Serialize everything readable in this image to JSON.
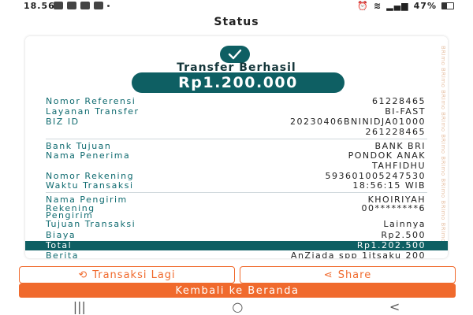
{
  "status_bar": {
    "time": "18.56",
    "battery": "47%"
  },
  "page": {
    "title": "Status"
  },
  "receipt": {
    "status": "Transfer Berhasil",
    "amount": "Rp1.200.000",
    "watermark": "BRImo BRImo BRImo BRImo BRImo BRImo BRImo BRImo BRImo",
    "details": [
      {
        "label": "Nomor Referensi",
        "value": "61228465"
      },
      {
        "label": "Layanan Transfer",
        "value": "BI-FAST"
      },
      {
        "label": "BIZ ID",
        "value": "20230406BNINIDJA01000",
        "value2": "261228465"
      },
      {
        "label": "Bank Tujuan",
        "value": "BANK BRI"
      },
      {
        "label": "Nama Penerima",
        "value": "PONDOK ANAK",
        "value2": "TAHFIDHU"
      },
      {
        "label": "Nomor Rekening",
        "value": "593601005247530"
      },
      {
        "label": "Waktu Transaksi",
        "value": "18:56:15 WIB"
      },
      {
        "label": "Nama Pengirim",
        "value": "KHOIRIYAH"
      },
      {
        "label": "Rekening",
        "label2": "Pengirim",
        "value": "00********6"
      },
      {
        "label": "Tujuan Transaksi",
        "value": "Lainnya"
      },
      {
        "label": "Biaya",
        "value": "Rp2.500"
      },
      {
        "label": "Total",
        "value": "Rp1.202.500"
      },
      {
        "label": "Berita",
        "value": "AnZiada spp 1jtsaku 200"
      }
    ]
  },
  "buttons": {
    "repeat": "Transaksi Lagi",
    "share": "Share",
    "home": "Kembali ke Beranda"
  },
  "nav": {
    "recent": "|||",
    "home": "○",
    "back": "<"
  },
  "colors": {
    "primary": "#0e5f63",
    "accent": "#f06a2d"
  }
}
